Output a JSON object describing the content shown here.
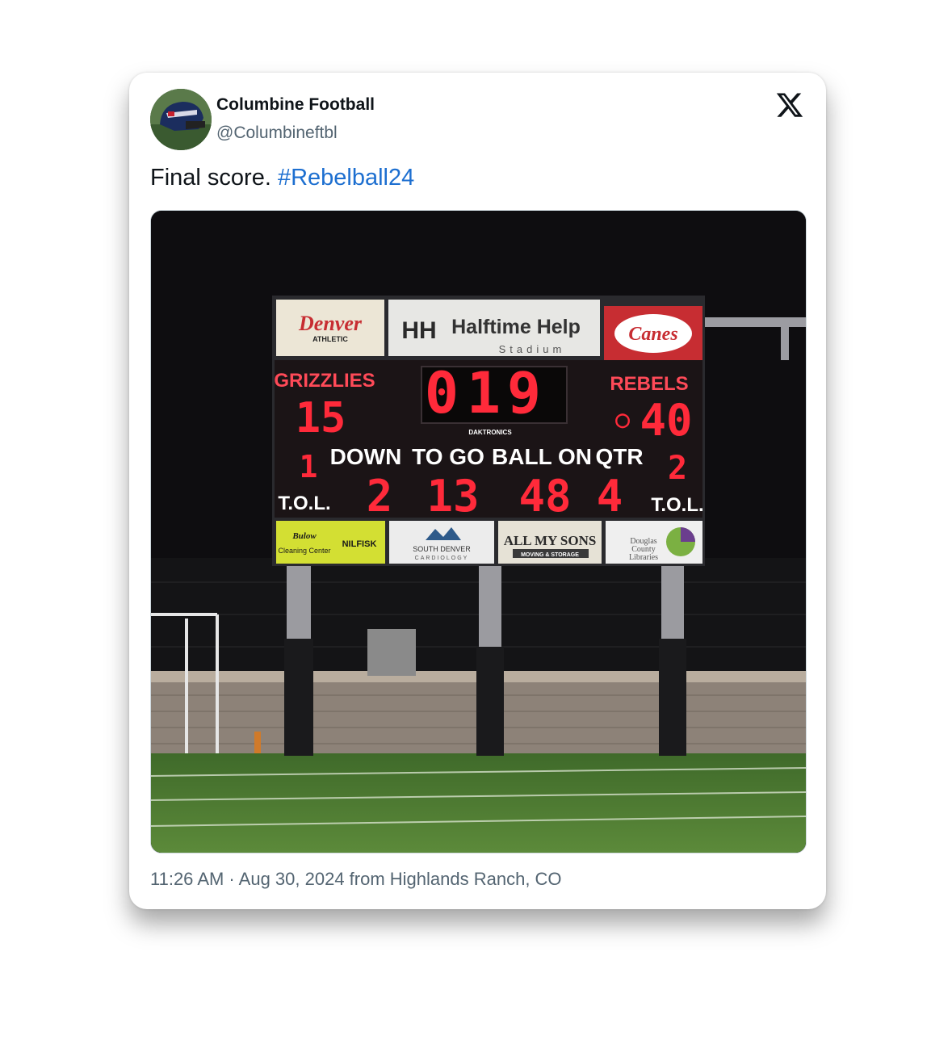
{
  "tweet": {
    "author_name": "Columbine Football",
    "handle": "@Columbineftbl",
    "text": "Final score.",
    "hashtag": "#Rebelball24",
    "timestamp": "11:26 AM · Aug 30, 2024 from Highlands Ranch, CO",
    "platform_icon": "x-logo-icon"
  },
  "scoreboard": {
    "home_team": "GRIZZLIES",
    "home_score": "15",
    "away_team": "REBELS",
    "away_score": "40",
    "clock": "0:19",
    "clock_digits": [
      "0",
      "1",
      "9"
    ],
    "maker": "DAKTRONICS",
    "down_label": "DOWN",
    "down": "2",
    "togo_label": "TO GO",
    "togo": "13",
    "ballon_label": "BALL ON",
    "ballon": "48",
    "qtr_label": "QTR",
    "qtr": "4",
    "tol_label": "T.O.L.",
    "home_tol": "1",
    "away_tol": "2",
    "possession_indicator": "○"
  },
  "sponsors": {
    "top_left": "Denver",
    "top_left_sub": "ATHLETIC",
    "top_center_logo": "HH",
    "top_center": "Halftime Help",
    "top_center_sub": "Stadium",
    "top_right": "Canes",
    "bottom_1a": "Bulow",
    "bottom_1b": "Cleaning Center",
    "bottom_1c": "NILFISK",
    "bottom_2a": "SOUTH DENVER",
    "bottom_2b": "CARDIOLOGY",
    "bottom_3a": "ALL MY SONS",
    "bottom_3b": "MOVING & STORAGE",
    "bottom_4a": "Douglas",
    "bottom_4b": "County",
    "bottom_4c": "Libraries"
  },
  "colors": {
    "link": "#1d6fd0",
    "led_red": "#ff2a3a",
    "text_primary": "#0f1419",
    "text_secondary": "#536471"
  }
}
